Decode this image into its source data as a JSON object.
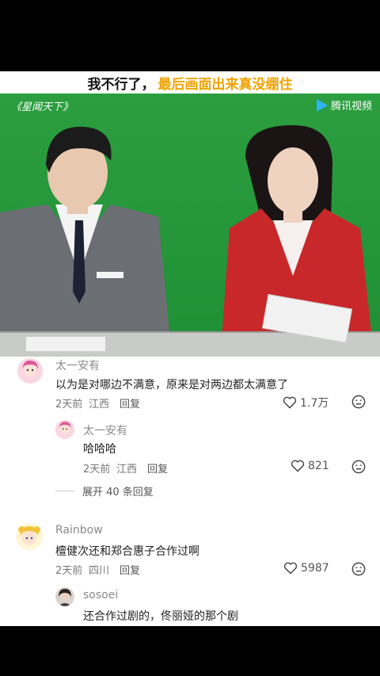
{
  "title_banner": {
    "part1": "我不行了，",
    "part2": "最后画面出来真没绷住"
  },
  "video": {
    "show_name": "《星闻天下》",
    "platform_logo": "腾讯视频",
    "colors": {
      "greenscreen": "#2a9c3c",
      "highlight": "#f0a200"
    }
  },
  "comments": [
    {
      "username": "太一安有",
      "text": "以为是对哪边不满意，原来是对两边都太满意了",
      "time": "2天前",
      "location": "江西",
      "reply_label": "回复",
      "likes": "1.7万",
      "replies": [
        {
          "username": "太一安有",
          "text": "哈哈哈",
          "time": "2天前",
          "location": "江西",
          "reply_label": "回复",
          "likes": "821"
        }
      ],
      "expand_label": "展开 40 条回复"
    },
    {
      "username": "Rainbow",
      "text": "檀健次还和郑合惠子合作过啊",
      "time": "2天前",
      "location": "四川",
      "reply_label": "回复",
      "likes": "5987",
      "replies": [
        {
          "username": "sosoei",
          "text": "还合作过剧的，佟丽娅的那个剧"
        }
      ]
    }
  ]
}
